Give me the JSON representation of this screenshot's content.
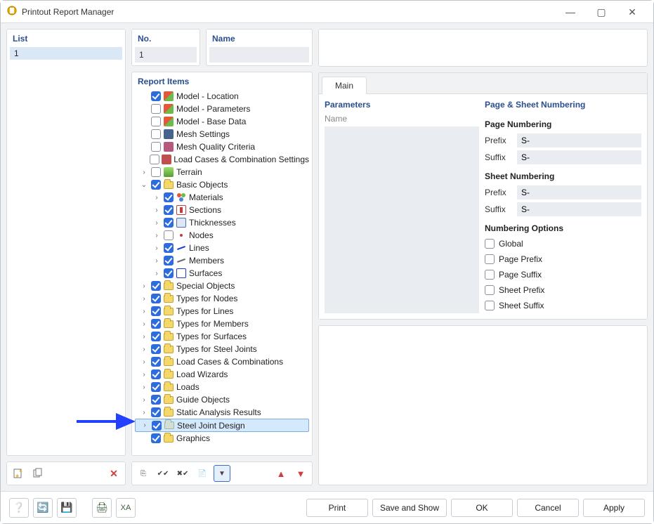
{
  "window": {
    "title": "Printout Report Manager"
  },
  "left": {
    "header": "List",
    "items": [
      "1"
    ],
    "selected_index": 0
  },
  "no_panel": {
    "header": "No.",
    "value": "1"
  },
  "name_panel": {
    "header": "Name",
    "value": ""
  },
  "report_items_header": "Report Items",
  "tree": [
    {
      "indent": 0,
      "exp": "",
      "chk": true,
      "icon": "ic-chart",
      "label": "Model - Location"
    },
    {
      "indent": 0,
      "exp": "",
      "chk": false,
      "icon": "ic-chart",
      "label": "Model - Parameters"
    },
    {
      "indent": 0,
      "exp": "",
      "chk": false,
      "icon": "ic-chart",
      "label": "Model - Base Data"
    },
    {
      "indent": 0,
      "exp": "",
      "chk": false,
      "icon": "ic-mesh",
      "label": "Mesh Settings"
    },
    {
      "indent": 0,
      "exp": "",
      "chk": false,
      "icon": "ic-mesh2",
      "label": "Mesh Quality Criteria"
    },
    {
      "indent": 0,
      "exp": "",
      "chk": false,
      "icon": "ic-load",
      "label": "Load Cases & Combination Settings"
    },
    {
      "indent": 0,
      "exp": "r",
      "chk": false,
      "icon": "ic-terrain",
      "label": "Terrain"
    },
    {
      "indent": 0,
      "exp": "d",
      "chk": true,
      "icon": "folder",
      "label": "Basic Objects"
    },
    {
      "indent": 1,
      "exp": "r",
      "chk": true,
      "icon": "ic-materials",
      "label": "Materials"
    },
    {
      "indent": 1,
      "exp": "r",
      "chk": true,
      "icon": "ic-section",
      "label": "Sections"
    },
    {
      "indent": 1,
      "exp": "r",
      "chk": true,
      "icon": "ic-thick",
      "label": "Thicknesses"
    },
    {
      "indent": 1,
      "exp": "r",
      "chk": false,
      "icon": "ic-node",
      "label": "Nodes"
    },
    {
      "indent": 1,
      "exp": "r",
      "chk": true,
      "icon": "ic-line",
      "label": "Lines"
    },
    {
      "indent": 1,
      "exp": "r",
      "chk": true,
      "icon": "ic-member",
      "label": "Members"
    },
    {
      "indent": 1,
      "exp": "r",
      "chk": true,
      "icon": "ic-surface",
      "label": "Surfaces"
    },
    {
      "indent": 0,
      "exp": "r",
      "chk": true,
      "icon": "folder",
      "label": "Special Objects"
    },
    {
      "indent": 0,
      "exp": "r",
      "chk": true,
      "icon": "folder",
      "label": "Types for Nodes"
    },
    {
      "indent": 0,
      "exp": "r",
      "chk": true,
      "icon": "folder",
      "label": "Types for Lines"
    },
    {
      "indent": 0,
      "exp": "r",
      "chk": true,
      "icon": "folder",
      "label": "Types for Members"
    },
    {
      "indent": 0,
      "exp": "r",
      "chk": true,
      "icon": "folder",
      "label": "Types for Surfaces"
    },
    {
      "indent": 0,
      "exp": "r",
      "chk": true,
      "icon": "folder",
      "label": "Types for Steel Joints"
    },
    {
      "indent": 0,
      "exp": "r",
      "chk": true,
      "icon": "folder",
      "label": "Load Cases & Combinations"
    },
    {
      "indent": 0,
      "exp": "r",
      "chk": true,
      "icon": "folder",
      "label": "Load Wizards"
    },
    {
      "indent": 0,
      "exp": "r",
      "chk": true,
      "icon": "folder",
      "label": "Loads"
    },
    {
      "indent": 0,
      "exp": "r",
      "chk": true,
      "icon": "folder",
      "label": "Guide Objects"
    },
    {
      "indent": 0,
      "exp": "r",
      "chk": true,
      "icon": "folder",
      "label": "Static Analysis Results"
    },
    {
      "indent": 0,
      "exp": "r",
      "chk": true,
      "icon": "folder-muted",
      "label": "Steel Joint Design",
      "hilite": true
    },
    {
      "indent": 0,
      "exp": "",
      "chk": true,
      "icon": "folder",
      "label": "Graphics"
    }
  ],
  "left_tb": {
    "new": "new-report-icon",
    "copy": "copy-report-icon",
    "delete": "delete-report-icon"
  },
  "mid_tb": {
    "btns": [
      {
        "name": "clone-icon",
        "glyph": "⎘"
      },
      {
        "name": "check-all-icon",
        "glyph": "✔✔"
      },
      {
        "name": "uncheck-all-icon",
        "glyph": "✖✔"
      },
      {
        "name": "template-icon",
        "glyph": "📄"
      },
      {
        "name": "filter-icon",
        "glyph": "▼",
        "active": true
      }
    ],
    "up": "▲",
    "down": "▼"
  },
  "tabs": {
    "main": "Main"
  },
  "params": {
    "header": "Parameters",
    "name_label": "Name",
    "name_value": ""
  },
  "numbering": {
    "header": "Page & Sheet Numbering",
    "page_hd": "Page Numbering",
    "sheet_hd": "Sheet Numbering",
    "opts_hd": "Numbering Options",
    "prefix_label": "Prefix",
    "suffix_label": "Suffix",
    "page_prefix": "S-",
    "page_suffix": "S-",
    "sheet_prefix": "S-",
    "sheet_suffix": "S-",
    "opts": [
      {
        "label": "Global",
        "checked": false
      },
      {
        "label": "Page Prefix",
        "checked": false
      },
      {
        "label": "Page Suffix",
        "checked": false
      },
      {
        "label": "Sheet Prefix",
        "checked": false
      },
      {
        "label": "Sheet Suffix",
        "checked": false
      }
    ]
  },
  "bottom": {
    "print": "Print",
    "save_show": "Save and Show",
    "ok": "OK",
    "cancel": "Cancel",
    "apply": "Apply"
  }
}
